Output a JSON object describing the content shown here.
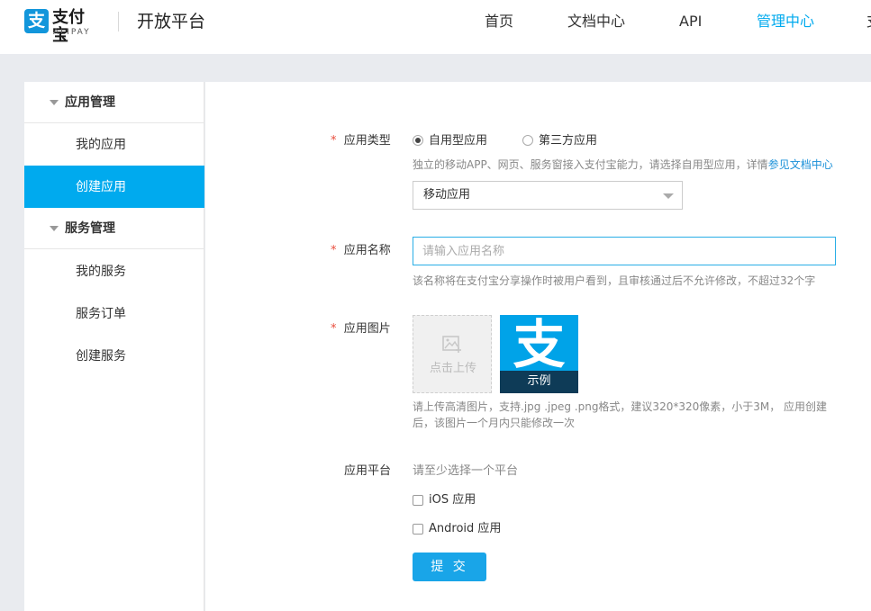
{
  "header": {
    "logo_cn": "支付宝",
    "logo_en": "ALIPAY",
    "site_title": "开放平台",
    "nav": [
      "首页",
      "文档中心",
      "API",
      "管理中心",
      "支"
    ],
    "active_nav": "管理中心",
    "accent_color": "#00aaee"
  },
  "sidebar": {
    "groups": [
      {
        "label": "应用管理",
        "items": [
          "我的应用",
          "创建应用"
        ]
      },
      {
        "label": "服务管理",
        "items": [
          "我的服务",
          "服务订单",
          "创建服务"
        ]
      }
    ],
    "active_item": "创建应用"
  },
  "form": {
    "app_type": {
      "required_mark": "*",
      "label": "应用类型",
      "options": [
        "自用型应用",
        "第三方应用"
      ],
      "selected": "自用型应用",
      "hint_text": "独立的移动APP、网页、服务窗接入支付宝能力，请选择自用型应用，详情",
      "hint_link": "参见文档中心",
      "select_value": "移动应用"
    },
    "app_name": {
      "required_mark": "*",
      "label": "应用名称",
      "placeholder": "请输入应用名称",
      "value": "",
      "hint": "该名称将在支付宝分享操作时被用户看到，且审核通过后不允许修改，不超过32个字"
    },
    "app_image": {
      "required_mark": "*",
      "label": "应用图片",
      "upload_text": "点击上传",
      "upload_icon": "image-upload-icon",
      "example_glyph": "支",
      "example_label": "示例",
      "hint_line1": "请上传高清图片，支持.jpg .jpeg .png格式，建议320*320像素，小于3M， 应用创建",
      "hint_line2": "后，该图片一个月内只能修改一次"
    },
    "platform": {
      "label": "应用平台",
      "hint": "请至少选择一个平台",
      "options": [
        "iOS 应用",
        "Android 应用"
      ],
      "checked": []
    },
    "submit_label": "提 交"
  }
}
